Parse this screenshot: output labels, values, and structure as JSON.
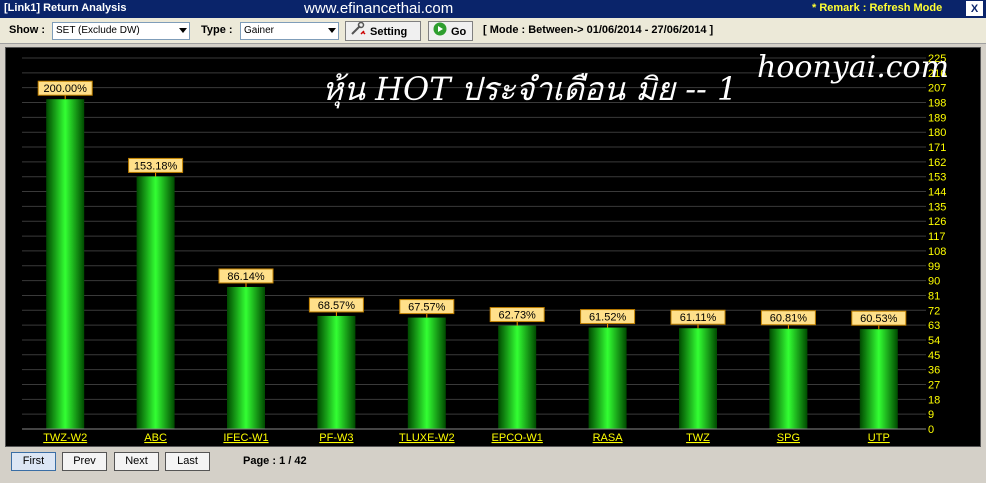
{
  "window": {
    "title": "[Link1] Return Analysis",
    "watermark": "www.efinancethai.com",
    "remark": "* Remark : Refresh Mode",
    "close_label": "X"
  },
  "toolbar": {
    "show_label": "Show :",
    "show_value": "SET (Exclude DW)",
    "type_label": "Type :",
    "type_value": "Gainer",
    "setting_label": "Setting",
    "go_label": "Go",
    "mode_text": "[ Mode : Between-> 01/06/2014 - 27/06/2014 ]"
  },
  "overlay": {
    "title": "หุ้น HOT ประจำเดือน มิย -- 1",
    "brand": "hoonyai.com"
  },
  "chart_data": {
    "type": "bar",
    "categories": [
      "TWZ-W2",
      "ABC",
      "IFEC-W1",
      "PF-W3",
      "TLUXE-W2",
      "EPCO-W1",
      "RASA",
      "TWZ",
      "SPG",
      "UTP"
    ],
    "values": [
      200.0,
      153.18,
      86.14,
      68.57,
      67.57,
      62.73,
      61.52,
      61.11,
      60.81,
      60.53
    ],
    "value_labels": [
      "200.00%",
      "153.18%",
      "86.14%",
      "68.57%",
      "67.57%",
      "62.73%",
      "61.52%",
      "61.11%",
      "60.81%",
      "60.53%"
    ],
    "ylim": [
      0,
      225
    ],
    "yticks": [
      "225",
      "216",
      "207",
      "198",
      "189",
      "180",
      "171",
      "162",
      "153",
      "144",
      "135",
      "126",
      "117",
      "108",
      "99",
      "90",
      "81",
      "72",
      "63",
      "54",
      "45",
      "36",
      "27",
      "18",
      "9",
      "0"
    ],
    "grid": true,
    "bar_color": "#00e000",
    "label_bg": "#ffe08a"
  },
  "footer": {
    "first_label": "First",
    "prev_label": "Prev",
    "next_label": "Next",
    "last_label": "Last",
    "page_text": "Page : 1 / 42"
  }
}
